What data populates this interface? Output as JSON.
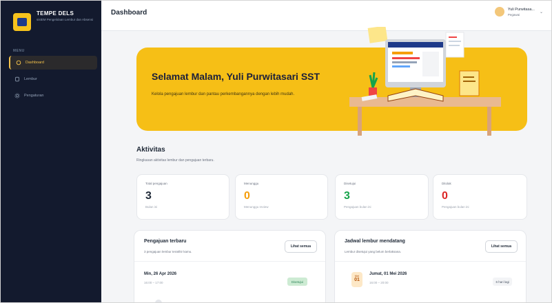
{
  "brand": {
    "name": "TEMPE DELS",
    "subtitle": "sistEM Pengelolaan Lembur dan Absensi"
  },
  "sidebar": {
    "menu_label": "MENU",
    "items": [
      {
        "label": "Dashboard",
        "icon": "grid-icon",
        "active": true
      },
      {
        "label": "Lembur",
        "icon": "clipboard-icon",
        "active": false
      },
      {
        "label": "Pengaturan",
        "icon": "gear-icon",
        "active": false
      }
    ]
  },
  "header": {
    "title": "Dashboard",
    "user_name": "Yuli Purwitasa...",
    "user_role": "Pegawai"
  },
  "banner": {
    "title": "Selamat Malam, Yuli Purwitasari SST",
    "text": "Kelola pengajuan lembur dan pantau perkembangannya dengan lebih mudah."
  },
  "activity": {
    "title": "Aktivitas",
    "subtitle": "Ringkasan aktivitas lembur dan pengajuan terbaru.",
    "stats": [
      {
        "label": "Total pengajuan",
        "value": "3",
        "note": "Bulan ini",
        "color": "#1f2937"
      },
      {
        "label": "Menunggu",
        "value": "0",
        "note": "Menunggu review",
        "color": "#f59e0b"
      },
      {
        "label": "Disetujui",
        "value": "3",
        "note": "Pengajuan bulan ini",
        "color": "#16a34a"
      },
      {
        "label": "Ditolak",
        "value": "0",
        "note": "Pengajuan bulan ini",
        "color": "#dc2626"
      }
    ]
  },
  "recent": {
    "title": "Pengajuan terbaru",
    "subtitle": "3 pengajuan lembur terakhir kamu.",
    "button": "Lihat semua",
    "item": {
      "date": "Min, 26 Apr 2026",
      "time": "16:00 – 17:00",
      "status": "Disetujui"
    }
  },
  "schedule": {
    "title": "Jadwal lembur mendatang",
    "subtitle": "Lembur disetujui yang belum berlaksana.",
    "button": "Lihat semua",
    "item": {
      "chip_month": "Mei",
      "chip_day": "01",
      "date": "Jumat, 01 Mei 2026",
      "time": "16:00 – 20:00",
      "days_left": "6 hari lagi"
    }
  }
}
